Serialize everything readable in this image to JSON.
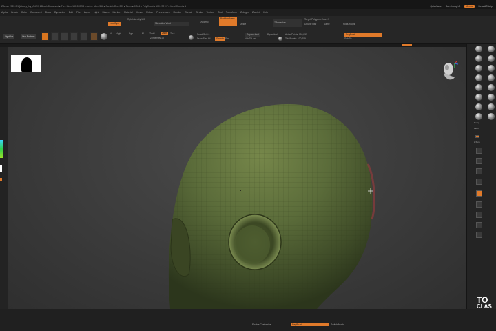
{
  "titlebar": {
    "title": "ZBrush 2022.0.1 [Alexey_Ivy_ALEX] ZBrush Document  ▸ Free Mem 130.559GB ▸ Active Mem 352 ▸ Scratch Disk 205 ▸ Timer ▸ 0.004 ▸ PolyCount ▸ 100.232 KP ▸ MeshCount ▸ 1",
    "quicksave": "QuickSave",
    "see_through": "See-through 0",
    "menus": "Menus",
    "default_zscript": "DefaultZScript"
  },
  "menubar": {
    "items": [
      "Alpha",
      "Brush",
      "Color",
      "Document",
      "Draw",
      "Dynamics",
      "Edit",
      "File",
      "Layer",
      "Light",
      "Macro",
      "Marker",
      "Material",
      "Movie",
      "Picker",
      "Preferences",
      "Render",
      "Stencil",
      "Stroke",
      "Texture",
      "Tool",
      "Transform",
      "Zplugin",
      "Zscript",
      "Help"
    ]
  },
  "toolbar": {
    "lightbox": "LightBox",
    "live_boolean": "Live Boolean",
    "edit": "Edit",
    "draw": "Draw",
    "move": "Move",
    "scale": "Scale",
    "rotate": "Rotate",
    "mrgb": "Mrgb",
    "rgb": "Rgb",
    "m": "M",
    "zadd": "Zadd",
    "zsub": "Zsub",
    "zcut": "Zcut",
    "focal_shift": "Focal Shift 0",
    "draw_size": "Draw Size 64",
    "dynamic": "Dynamic",
    "z_intensity": "Z Intensity 18",
    "rgb_intensity": "Rgb Intensity 100",
    "mirror_and_weld": "Mirror And Weld",
    "local_sym": "LocalSym",
    "backface_mask": "BackfaceMask",
    "active_points": "ActivePoints: 100,259",
    "total_points": "TotalPoints: 100,259",
    "replace_last": "ReplaceLast",
    "add_to_last": "AddToLast",
    "dynamesh": "DynaMesh",
    "smooth": "Smooth",
    "target_polygons": "Target Polygons Count 5",
    "double_half": "Double Half",
    "same": "Same",
    "fold_groups": "FoldGroups",
    "zremesher": "ZRemesher",
    "keep_groups": "KeepGroups",
    "divide": "Divide",
    "smt": "Smt",
    "brush_label": "RegBrush",
    "sub_ids": "SubIDs"
  },
  "rightpanel": {
    "labels": [
      "Persp",
      "Floor",
      "L.Sym",
      "Frame",
      "Move",
      "Zoom3D",
      "Rotate",
      "Transp",
      "Ghost",
      "Solo",
      "Xpose"
    ]
  },
  "watermark": {
    "line1": "TO",
    "line2": "CLAS"
  },
  "bottombar": {
    "enable_customize": "Enable Customize",
    "regbrush": "RegBrush",
    "switch_brush": "SwitchBrush"
  },
  "colors": {
    "accent": "#e07a2a",
    "mesh_green": "#5c6a3c",
    "viewport_bg": "#3c3c3c"
  }
}
